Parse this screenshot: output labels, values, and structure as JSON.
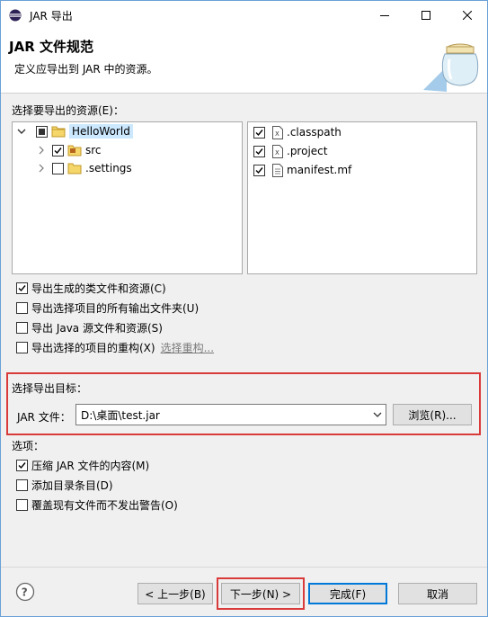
{
  "window": {
    "title": "JAR 导出",
    "controls": [
      "minimize",
      "maximize",
      "close"
    ]
  },
  "header": {
    "title": "JAR 文件规范",
    "description": "定义应导出到 JAR 中的资源。",
    "graphic_icon": "jar-icon"
  },
  "resources": {
    "label": "选择要导出的资源(E)：",
    "tree": [
      {
        "label": "HelloWorld",
        "expanded": true,
        "check": "partial",
        "icon": "project-folder-icon",
        "selected": true
      },
      {
        "label": "src",
        "expanded": false,
        "check": "checked",
        "icon": "package-folder-icon"
      },
      {
        "label": ".settings",
        "expanded": false,
        "check": "unchecked",
        "icon": "folder-icon"
      }
    ],
    "files": [
      {
        "label": ".classpath",
        "check": "checked",
        "icon": "xml-file-icon"
      },
      {
        "label": ".project",
        "check": "checked",
        "icon": "xml-file-icon"
      },
      {
        "label": "manifest.mf",
        "check": "checked",
        "icon": "text-file-icon"
      }
    ]
  },
  "export_options": [
    {
      "label": "导出生成的类文件和资源(C)",
      "checked": true
    },
    {
      "label": "导出选择项目的所有输出文件夹(U)",
      "checked": false
    },
    {
      "label": "导出 Java 源文件和资源(S)",
      "checked": false
    },
    {
      "label": "导出选择的项目的重构(X)",
      "checked": false,
      "link": "选择重构..."
    }
  ],
  "destination": {
    "label": "选择导出目标：",
    "jar_label": "JAR 文件：",
    "jar_value": "D:\\桌面\\test.jar",
    "browse_label": "浏览(R)..."
  },
  "options": {
    "label": "选项：",
    "items": [
      {
        "label": "压缩 JAR 文件的内容(M)",
        "checked": true
      },
      {
        "label": "添加目录条目(D)",
        "checked": false
      },
      {
        "label": "覆盖现有文件而不发出警告(O)",
        "checked": false
      }
    ]
  },
  "footer": {
    "back_label": "< 上一步(B)",
    "next_label": "下一步(N) >",
    "finish_label": "完成(F)",
    "cancel_label": "取消"
  },
  "colors": {
    "highlight_red": "#d93a3a",
    "selection_blue": "#cce8ff",
    "accent_blue": "#0078d7"
  }
}
